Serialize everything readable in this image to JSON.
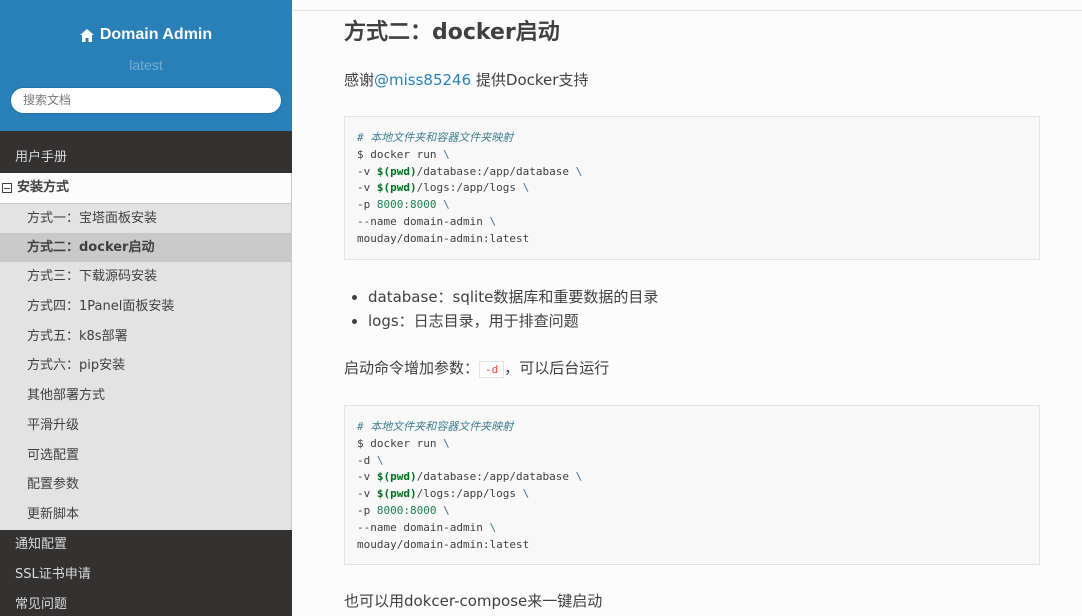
{
  "sidebar": {
    "brand": "Domain Admin",
    "version": "latest",
    "search_placeholder": "搜索文档",
    "top_items": [
      "用户手册"
    ],
    "current_section": "安装方式",
    "sub_items": [
      {
        "label": "方式一：宝塔面板安装",
        "active": false
      },
      {
        "label": "方式二：docker启动",
        "active": true
      },
      {
        "label": "方式三：下载源码安装",
        "active": false
      },
      {
        "label": "方式四：1Panel面板安装",
        "active": false
      },
      {
        "label": "方式五：k8s部署",
        "active": false
      },
      {
        "label": "方式六：pip安装",
        "active": false
      },
      {
        "label": "其他部署方式",
        "active": false
      },
      {
        "label": "平滑升级",
        "active": false
      },
      {
        "label": "可选配置",
        "active": false
      },
      {
        "label": "配置参数",
        "active": false
      },
      {
        "label": "更新脚本",
        "active": false
      }
    ],
    "bottom_items": [
      "通知配置",
      "SSL证书申请",
      "常见问题"
    ]
  },
  "content": {
    "heading": "方式二：docker启动",
    "thanks_prefix": "感谢",
    "thanks_link": "@miss85246",
    "thanks_suffix": " 提供Docker支持",
    "code1": {
      "comment": "# 本地文件夹和容器文件夹映射",
      "line2": "$ docker run ",
      "v1_prefix": "-v ",
      "pwd": "$(pwd)",
      "v1_rest": "/database:/app/database ",
      "v2_prefix": "-v ",
      "v2_rest": "/logs:/app/logs ",
      "p_prefix": "-p ",
      "port": "8000:8000",
      "name_line": "--name domain-admin ",
      "image": "mouday/domain-admin:latest",
      "backslash": "\\"
    },
    "list": [
      "database：sqlite数据库和重要数据的目录",
      "logs：日志目录，用于排查问题"
    ],
    "daemon_prefix": "启动命令增加参数：",
    "daemon_flag": "-d",
    "daemon_suffix": "，可以后台运行",
    "code2": {
      "comment": "# 本地文件夹和容器文件夹映射",
      "line2": "$ docker run ",
      "d_line": "-d ",
      "v1_prefix": "-v ",
      "pwd": "$(pwd)",
      "v1_rest": "/database:/app/database ",
      "v2_prefix": "-v ",
      "v2_rest": "/logs:/app/logs ",
      "p_prefix": "-p ",
      "port": "8000:8000",
      "name_line": "--name domain-admin ",
      "image": "mouday/domain-admin:latest",
      "backslash": "\\"
    },
    "compose_text": "也可以用dokcer-compose来一键启动"
  }
}
